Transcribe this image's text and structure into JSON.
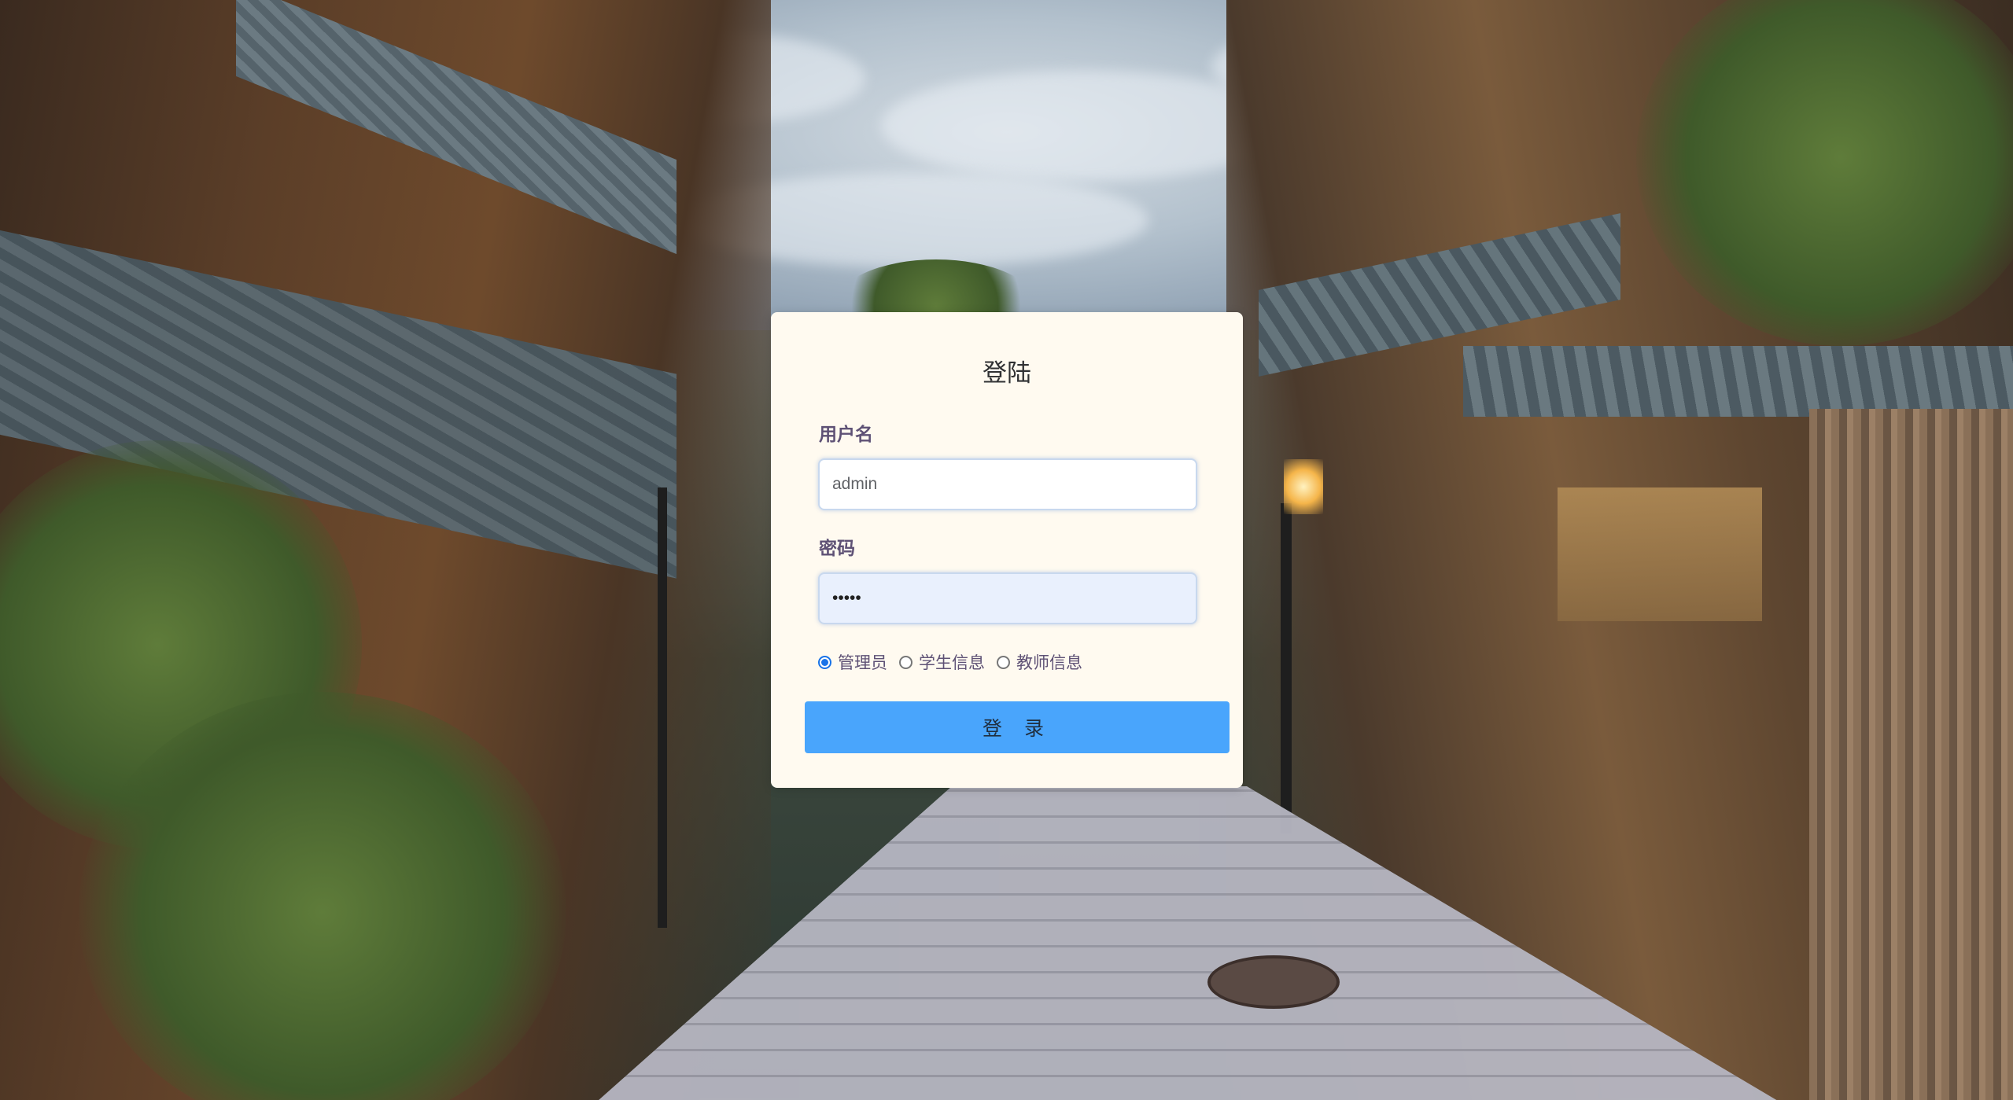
{
  "login": {
    "title": "登陆",
    "username_label": "用户名",
    "username_value": "admin",
    "password_label": "密码",
    "password_masked": "•••••",
    "roles": [
      {
        "label": "管理员",
        "checked": true
      },
      {
        "label": "学生信息",
        "checked": false
      },
      {
        "label": "教师信息",
        "checked": false
      }
    ],
    "submit_label": "登 录"
  },
  "colors": {
    "card_background": "#fffaf0",
    "button_primary": "#49a5fc",
    "label_text": "#5e5175",
    "radio_checked": "#1a73e8"
  },
  "background": {
    "description_icon": "kyoto-street-background-image"
  }
}
